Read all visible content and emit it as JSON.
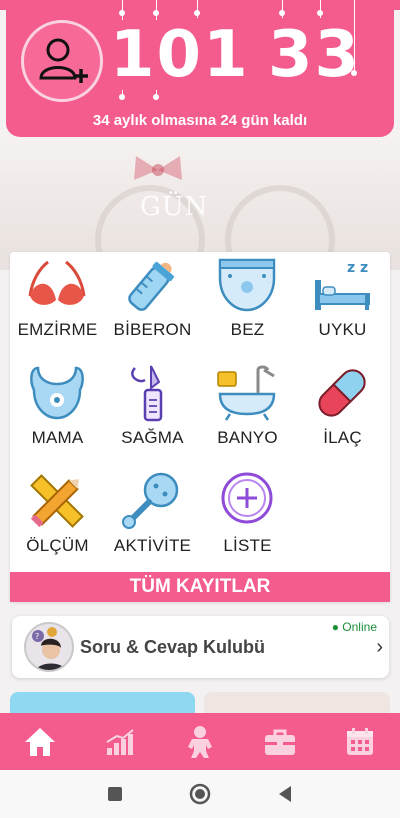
{
  "header": {
    "counter_left": "101",
    "counter_right": "33",
    "subtitle": "34 aylık olmasına 24 gün kaldı",
    "add_profile_icon": "person-add-icon"
  },
  "background": {
    "photo_text": "GÜN"
  },
  "activities": [
    {
      "label": "EMZİRME",
      "icon": "bra-icon"
    },
    {
      "label": "BİBERON",
      "icon": "baby-bottle-icon"
    },
    {
      "label": "BEZ",
      "icon": "diaper-icon"
    },
    {
      "label": "UYKU",
      "icon": "bed-sleep-icon"
    },
    {
      "label": "MAMA",
      "icon": "bib-icon"
    },
    {
      "label": "SAĞMA",
      "icon": "breast-pump-icon"
    },
    {
      "label": "BANYO",
      "icon": "bathtub-icon"
    },
    {
      "label": "İLAÇ",
      "icon": "pill-icon"
    },
    {
      "label": "ÖLÇÜM",
      "icon": "ruler-pencil-icon"
    },
    {
      "label": "AKTİVİTE",
      "icon": "rattle-icon"
    },
    {
      "label": "LİSTE",
      "icon": "plus-circle-icon"
    }
  ],
  "all_records_label": "TÜM KAYITLAR",
  "club": {
    "title": "Soru & Cevap Kulubü",
    "status": "● Online"
  },
  "bottom_nav": [
    "home-icon",
    "growth-chart-icon",
    "baby-icon",
    "briefcase-icon",
    "calendar-icon"
  ],
  "colors": {
    "primary": "#f45c8e",
    "online": "#1a8f3a"
  }
}
